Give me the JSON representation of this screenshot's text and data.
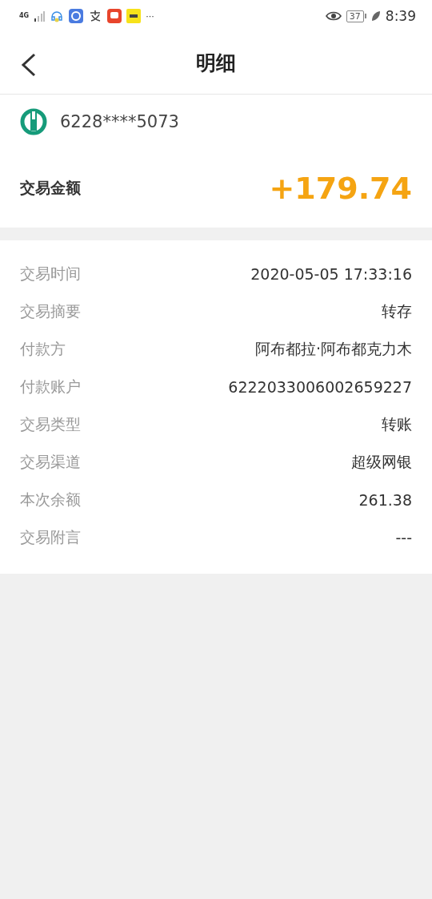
{
  "status_bar": {
    "network": "4G",
    "more": "···",
    "battery": "37",
    "time": "8:39"
  },
  "header": {
    "title": "明细"
  },
  "card": {
    "number": "6228****5073"
  },
  "amount": {
    "label": "交易金额",
    "value": "+179.74"
  },
  "details": [
    {
      "label": "交易时间",
      "value": "2020-05-05 17:33:16"
    },
    {
      "label": "交易摘要",
      "value": "转存"
    },
    {
      "label": "付款方",
      "value": "阿布都拉·阿布都克力木"
    },
    {
      "label": "付款账户",
      "value": "6222033006002659227"
    },
    {
      "label": "交易类型",
      "value": "转账"
    },
    {
      "label": "交易渠道",
      "value": "超级网银"
    },
    {
      "label": "本次余额",
      "value": "261.38"
    },
    {
      "label": "交易附言",
      "value": "---"
    }
  ]
}
